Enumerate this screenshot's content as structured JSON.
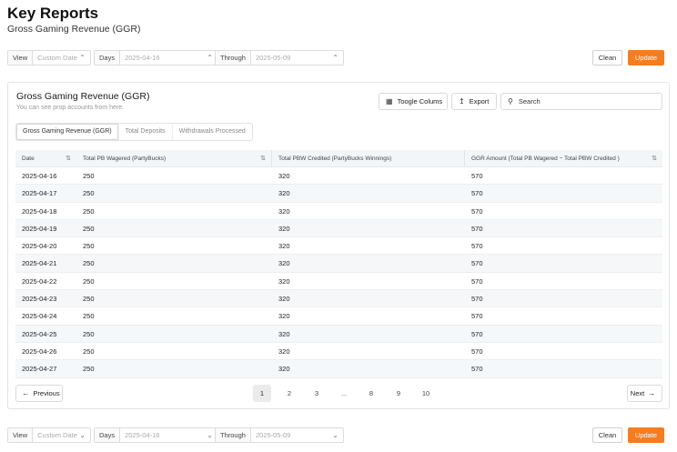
{
  "header": {
    "title": "Key Reports",
    "subtitle": "Gross Gaming Revenue (GGR)"
  },
  "filters": {
    "view_label": "View",
    "view_value": "Custom Date",
    "days_label": "Days",
    "days_value": "2025-04-16",
    "through_label": "Through",
    "through_value": "2025-05-09",
    "clean_label": "Clean",
    "update_label": "Update"
  },
  "card": {
    "title": "Gross Gaming Revenue (GGR)",
    "description": "You can see prop accounts from here.",
    "toggle_columns_label": "Toogle Colums",
    "export_label": "Export",
    "search_placeholder": "Search"
  },
  "tabs": [
    {
      "label": "Gross Gaming Revenue (GGR)",
      "active": true
    },
    {
      "label": "Total Deposits",
      "active": false
    },
    {
      "label": "Withdrawals Processed",
      "active": false
    }
  ],
  "table": {
    "columns": [
      "Date",
      "Total PB Wagered (PartyBucks)",
      "Total PBW Credited (PartyBucks Winnings)",
      "GGR Amount (Total PB Wagered − Total PBW Credited )"
    ],
    "rows": [
      [
        "2025-04-16",
        "250",
        "320",
        "570"
      ],
      [
        "2025-04-17",
        "250",
        "320",
        "570"
      ],
      [
        "2025-04-18",
        "250",
        "320",
        "570"
      ],
      [
        "2025-04-19",
        "250",
        "320",
        "570"
      ],
      [
        "2025-04-20",
        "250",
        "320",
        "570"
      ],
      [
        "2025-04-21",
        "250",
        "320",
        "570"
      ],
      [
        "2025-04-22",
        "250",
        "320",
        "570"
      ],
      [
        "2025-04-23",
        "250",
        "320",
        "570"
      ],
      [
        "2025-04-24",
        "250",
        "320",
        "570"
      ],
      [
        "2025-04-25",
        "250",
        "320",
        "570"
      ],
      [
        "2025-04-26",
        "250",
        "320",
        "570"
      ],
      [
        "2025-04-27",
        "250",
        "320",
        "570"
      ]
    ]
  },
  "pagination": {
    "previous_label": "Previous",
    "next_label": "Next",
    "pages": [
      "1",
      "2",
      "3",
      "...",
      "8",
      "9",
      "10"
    ],
    "current_page": "1"
  },
  "colors": {
    "accent": "#f57c1f"
  }
}
